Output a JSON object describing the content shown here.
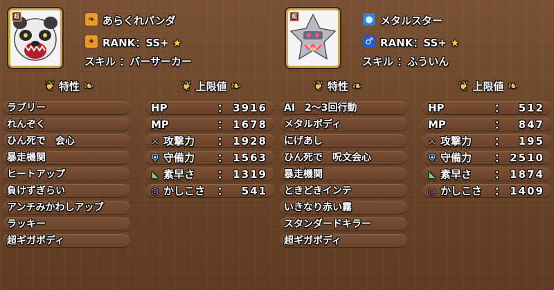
{
  "left": {
    "name": "あらくれパンダ",
    "rank": "RANK：SS+",
    "skill": "スキル ：バーサーカー",
    "traits_header": "特性",
    "stats_header": "上限値",
    "traits": [
      "ラブリー",
      "れんぞく",
      "ひん死で　会心",
      "暴走機関",
      "ヒートアップ",
      "負けずぎらい",
      "アンチみかわしアップ",
      "ラッキー",
      "超ギガボディ"
    ],
    "stats": [
      {
        "label": "HP",
        "value": "3916",
        "icon": ""
      },
      {
        "label": "MP",
        "value": "1678",
        "icon": ""
      },
      {
        "label": "攻撃力",
        "value": "1928",
        "icon": "sword-icon"
      },
      {
        "label": "守備力",
        "value": "1563",
        "icon": "shield-icon"
      },
      {
        "label": "素早さ",
        "value": "1319",
        "icon": "boot-icon"
      },
      {
        "label": "かしこさ",
        "value": "541",
        "icon": "ring-icon"
      }
    ]
  },
  "right": {
    "name": "メタルスター",
    "rank": "RANK：SS+",
    "skill": "スキル ：ふういん",
    "traits_header": "特性",
    "stats_header": "上限値",
    "traits": [
      "AI　2〜3回行動",
      "メタルボディ",
      "にげあし",
      "ひん死で　呪文会心",
      "暴走機関",
      "ときどきインテ",
      "いきなり赤い霧",
      "スタンダードキラー",
      "超ギガボディ"
    ],
    "stats": [
      {
        "label": "HP",
        "value": "512",
        "icon": ""
      },
      {
        "label": "MP",
        "value": "847",
        "icon": ""
      },
      {
        "label": "攻撃力",
        "value": "195",
        "icon": "sword-icon"
      },
      {
        "label": "守備力",
        "value": "2510",
        "icon": "shield-icon"
      },
      {
        "label": "素早さ",
        "value": "1874",
        "icon": "boot-icon"
      },
      {
        "label": "かしこさ",
        "value": "1409",
        "icon": "ring-icon"
      }
    ]
  },
  "colon": "：",
  "star": "★",
  "portrait_badge": "超",
  "colors": {
    "accent": "#e8c35a",
    "star": "#ffd335",
    "panel": "#6b4529"
  }
}
